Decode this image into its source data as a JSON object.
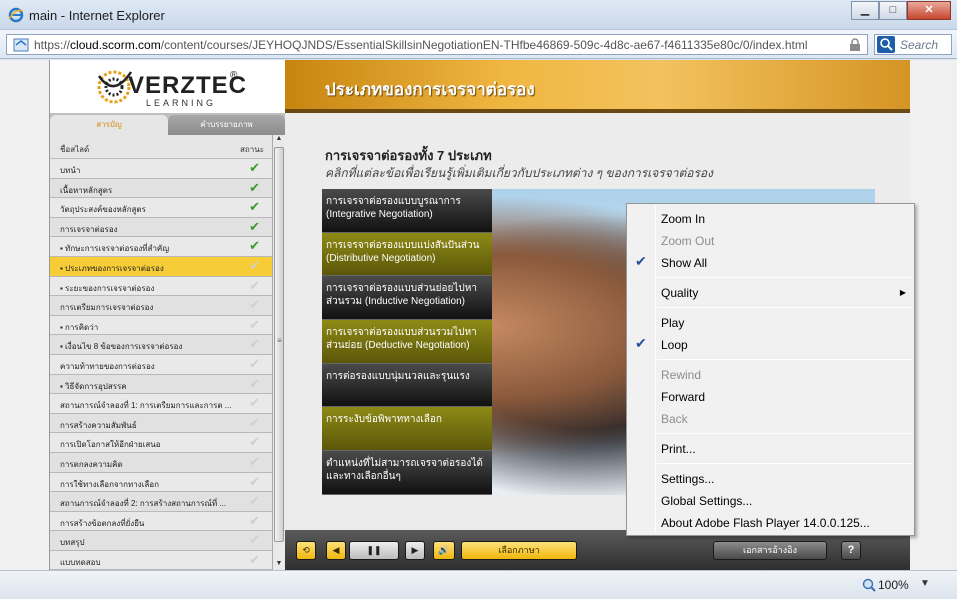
{
  "window": {
    "title": "main - Internet Explorer",
    "url_prefix": "https://",
    "url_domain": "cloud.scorm.com",
    "url_path": "/content/courses/JEYHOQJNDS/EssentialSkillsinNegotiationEN-THfbe46869-509c-4d8c-ae67-f4611335e80c/0/index.html",
    "search_placeholder": "Search",
    "zoom": "100%",
    "minimize": "▁",
    "maximize": "□",
    "close": "✕"
  },
  "course": {
    "logo": "VERZTEC",
    "logo_sub": "LEARNING",
    "logo_reg": "®",
    "header_title": "ประเภทของการเจรจาต่อรอง",
    "tabs": [
      "สารบัญ",
      "คำบรรยายภาพ"
    ],
    "list_head_left": "ชื่อสไลด์",
    "list_head_right": "สถานะ",
    "items": [
      {
        "label": "บทนำ",
        "done": true
      },
      {
        "label": "เนื้อหาหลักสูตร",
        "done": true
      },
      {
        "label": "วัตถุประสงค์ของหลักสูตร",
        "done": true
      },
      {
        "label": "การเจรจาต่อรอง",
        "done": true
      },
      {
        "label": "▪  ทักษะการเจรจาต่อรองที่สำคัญ",
        "done": true
      },
      {
        "label": "▪  ประเภทของการเจรจาต่อรอง",
        "done": false,
        "active": true
      },
      {
        "label": "▪  ระยะของการเจรจาต่อรอง",
        "done": false
      },
      {
        "label": "การเตรียมการเจรจาต่อรอง",
        "done": false
      },
      {
        "label": "▪  การคิดว่า",
        "done": false
      },
      {
        "label": "▪  เงื่อนไข 8 ข้อของการเจรจาต่อรอง",
        "done": false
      },
      {
        "label": "ความท้าทายของการต่อรอง",
        "done": false
      },
      {
        "label": "▪  วิธีจัดการอุปสรรค",
        "done": false
      },
      {
        "label": "สถานการณ์จำลองที่ 1: การเตรียมการและการต ...",
        "done": false
      },
      {
        "label": "การสร้างความสัมพันธ์",
        "done": false
      },
      {
        "label": "การเปิดโอกาสให้อีกฝ่ายเสนอ",
        "done": false
      },
      {
        "label": "การตกลงความคิด",
        "done": false
      },
      {
        "label": "การใช้ทางเลือกจากทางเลือก",
        "done": false
      },
      {
        "label": "สถานการณ์จำลองที่ 2: การสร้างสถานการณ์ที่ ...",
        "done": false
      },
      {
        "label": "การสร้างข้อตกลงที่ยั่งยืน",
        "done": false
      },
      {
        "label": "บทสรุป",
        "done": false
      },
      {
        "label": "แบบทดสอบ",
        "done": false
      }
    ],
    "main_title": "การเจรจาต่อรองทั้ง 7 ประเภท",
    "main_subtitle": "คลิกที่แต่ละข้อเพื่อเรียนรู้เพิ่มเติมเกี่ยวกับประเภทต่าง ๆ ของการเจรจาต่อรอง",
    "negotiations": [
      {
        "label": "การเจรจาต่อรองแบบบูรณาการ (Integrative Negotiation)",
        "style": "dark"
      },
      {
        "label": "การเจรจาต่อรองแบบแบ่งสันปันส่วน (Distributive Negotiation)",
        "style": "gold"
      },
      {
        "label": "การเจรจาต่อรองแบบส่วนย่อยไปหาส่วนรวม (Inductive Negotiation)",
        "style": "dark"
      },
      {
        "label": "การเจรจาต่อรองแบบส่วนรวมไปหาส่วนย่อย (Deductive Negotiation)",
        "style": "gold"
      },
      {
        "label": "การต่อรองแบบนุ่มนวลและรุนแรง",
        "style": "dark"
      },
      {
        "label": "การระงับข้อพิพาททางเลือก",
        "style": "gold"
      },
      {
        "label": "ตำแหน่งที่ไม่สามารถเจรจาต่อรองได้และทางเลือกอื่นๆ",
        "style": "dark"
      }
    ],
    "controls": {
      "replay": "⟲",
      "prev": "◀",
      "pause": "❚❚",
      "next": "▶",
      "volume": "🔊",
      "language": "เลือกภาษา",
      "references": "เอกสารอ้างอิง",
      "help": "?"
    }
  },
  "context_menu": {
    "zoom_in": "Zoom In",
    "zoom_out": "Zoom Out",
    "show_all": "Show All",
    "quality": "Quality",
    "play": "Play",
    "loop": "Loop",
    "rewind": "Rewind",
    "forward": "Forward",
    "back": "Back",
    "print": "Print...",
    "settings": "Settings...",
    "global_settings": "Global Settings...",
    "about": "About Adobe Flash Player 14.0.0.125..."
  }
}
